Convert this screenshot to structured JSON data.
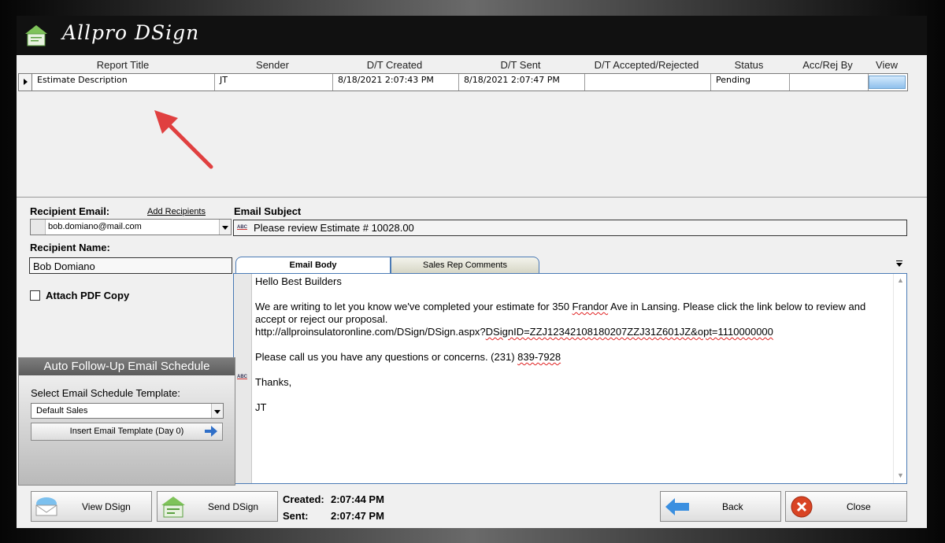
{
  "app": {
    "title": "Allpro DSign"
  },
  "grid": {
    "columns": [
      "Report Title",
      "Sender",
      "D/T Created",
      "D/T Sent",
      "D/T Accepted/Rejected",
      "Status",
      "Acc/Rej By",
      "View"
    ],
    "rows": [
      {
        "report_title": "Estimate Description",
        "sender": "JT",
        "created": "8/18/2021 2:07:43 PM",
        "sent": "8/18/2021 2:07:47 PM",
        "accepted_rejected": "",
        "status": "Pending",
        "acc_rej_by": ""
      }
    ]
  },
  "recipient": {
    "email_label": "Recipient Email:",
    "add_recipients": "Add Recipients",
    "email_value": "bob.domiano@mail.com",
    "name_label": "Recipient Name:",
    "name_value": "Bob Domiano",
    "attach_pdf_label": "Attach PDF Copy",
    "attach_pdf_checked": false
  },
  "email": {
    "subject_label": "Email Subject",
    "subject_value": "Please review Estimate # 10028.00",
    "tabs": [
      "Email Body",
      "Sales Rep Comments"
    ],
    "active_tab": "Email Body",
    "body": {
      "greeting": "Hello Best Builders",
      "para1_a": "We are writing to let you know we've completed your estimate for 350 ",
      "para1_frandor": "Frandor",
      "para1_b": " Ave in Lansing. Please click the link below to review and accept or reject our proposal.",
      "link_a": "http://allproinsulatoronline.com/DSign/DSign.aspx?",
      "link_b": "DSignID=ZZJ12342108180207ZZJ31Z601JZ&opt=1110000000",
      "para2": "Please call us you have any questions or concerns. (231) ",
      "phone": "839-7928",
      "thanks": "Thanks,",
      "signoff": "JT"
    }
  },
  "followup": {
    "title": "Auto Follow-Up Email Schedule",
    "template_label": "Select Email Schedule Template:",
    "template_value": "Default Sales",
    "insert_button": "Insert Email Template (Day 0)"
  },
  "footer": {
    "view_button": "View DSign",
    "send_button": "Send DSign",
    "created_label": "Created:",
    "created_value": "2:07:44 PM",
    "sent_label": "Sent:",
    "sent_value": "2:07:47 PM",
    "back_button": "Back",
    "close_button": "Close"
  },
  "colors": {
    "accent_blue": "#4a7ab5",
    "arrow_red": "#e04040",
    "close_red": "#d94424"
  }
}
